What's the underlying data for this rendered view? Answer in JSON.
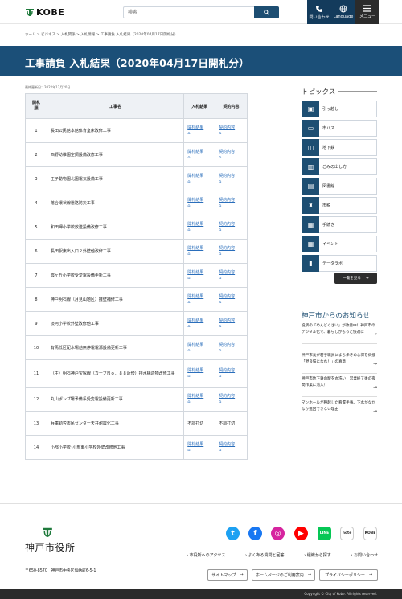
{
  "header": {
    "logo_text": "KOBE",
    "search_placeholder": "検索",
    "inquiry_label": "問い合わせ",
    "language_label": "Language",
    "menu_label": "メニュー"
  },
  "breadcrumb": "ホーム > ビジネス > 入札関係 > 入札情報 > 工事請負 入札結果（2020年04月17日開札分）",
  "page_title": "工事請負 入札結果（2020年04月17日開札分）",
  "updated": "最終更新日：2022年12月20日",
  "table": {
    "headers": {
      "num": "開札\n順",
      "name": "工事名",
      "result": "入札結果",
      "detail": "契約内容"
    },
    "link_label": "開札結果",
    "detail_label": "契約内容",
    "no_bid_label": "不調打切",
    "rows": [
      {
        "num": "1",
        "name": "長田公民館本館体育室床改修工事",
        "status": "link"
      },
      {
        "num": "2",
        "name": "西野幼稚園空調設備改修工事",
        "status": "link"
      },
      {
        "num": "3",
        "name": "王子動物園北園電気設備工事",
        "status": "link"
      },
      {
        "num": "4",
        "name": "落合環状線道路防災工事",
        "status": "link"
      },
      {
        "num": "5",
        "name": "和田岬小学校放送設備改修工事",
        "status": "link"
      },
      {
        "num": "6",
        "name": "長田駅東出入口２外壁他改修工事",
        "status": "link"
      },
      {
        "num": "7",
        "name": "霞ヶ丘小学校受変電設備更新工事",
        "status": "link"
      },
      {
        "num": "8",
        "name": "神戸明石線（月見山地区）擁壁補修工事",
        "status": "link"
      },
      {
        "num": "9",
        "name": "淡河小学校外壁改修他工事",
        "status": "link"
      },
      {
        "num": "10",
        "name": "有馬低区配水場他無停電電源設備更新工事",
        "status": "link"
      },
      {
        "num": "11",
        "name": "（主）明石神戸宝塚線（カーブＮｏ．８８近傍）排水構造物改修工事",
        "status": "link"
      },
      {
        "num": "12",
        "name": "丸山ポンプ場予備系受変電設備更新工事",
        "status": "link"
      },
      {
        "num": "13",
        "name": "兵庫勤労市民センター天井耐震化工事",
        "status": "nobid"
      },
      {
        "num": "14",
        "name": "小部小学校･小部東小学校外壁改修他工事",
        "status": "link"
      }
    ]
  },
  "sidebar": {
    "topics_title": "トピックス",
    "topics": [
      {
        "label": "引っ越し",
        "icon": "moving-box-icon"
      },
      {
        "label": "市バス",
        "icon": "bus-icon"
      },
      {
        "label": "地下鉄",
        "icon": "subway-icon"
      },
      {
        "label": "ごみの出し方",
        "icon": "trash-icon"
      },
      {
        "label": "図書館",
        "icon": "book-icon"
      },
      {
        "label": "市税",
        "icon": "tax-icon"
      },
      {
        "label": "手続き",
        "icon": "document-icon"
      },
      {
        "label": "イベント",
        "icon": "calendar-icon"
      },
      {
        "label": "データラボ",
        "icon": "chart-icon"
      }
    ],
    "list_all_label": "一覧を見る",
    "news_title": "神戸市からのお知らせ",
    "news": [
      "役所の「めんどくさい」が改善中！神戸市のデジタル化で、暮らしがもっと快適に",
      "神戸市長が若手職員にまち歩きの心得を伝授「野良猫になれ！」の真意",
      "神戸市地下鉄の駅を丸洗い　営業終了後の夜間作業に潜入！",
      "マンホールが種起した看置手事。下水がなかなか進回できない理由"
    ]
  },
  "footer": {
    "city_name": "神戸市役所",
    "sns": [
      {
        "name": "twitter-icon",
        "glyph": "t",
        "color": "#1da1f2"
      },
      {
        "name": "facebook-icon",
        "glyph": "f",
        "color": "#1877f2"
      },
      {
        "name": "instagram-icon",
        "glyph": "◎",
        "color": "#d6249f"
      },
      {
        "name": "youtube-icon",
        "glyph": "▶",
        "color": "#ff0000"
      },
      {
        "name": "line-icon",
        "glyph": "LINE",
        "color": "#06c755"
      },
      {
        "name": "note-icon",
        "glyph": "note",
        "color": "#ffffff"
      },
      {
        "name": "kobe-app-icon",
        "glyph": "KOBE",
        "color": "#ffffff"
      }
    ],
    "links": [
      "› 市役所へのアクセス",
      "› よくある質問と回答",
      "› 組織から探す",
      "› お問い合わせ"
    ],
    "address": "〒650-8570　神戸市中央区加納町6-5-1",
    "buttons": [
      "サイトマップ",
      "ホームページのご利用案内",
      "プライバシーポリシー"
    ],
    "copyright": "Copyright © City of Kobe. All rights reserved."
  },
  "colors": {
    "navy": "#1b4f78",
    "link": "#2a6ebb",
    "dark": "#2b2b2b"
  }
}
